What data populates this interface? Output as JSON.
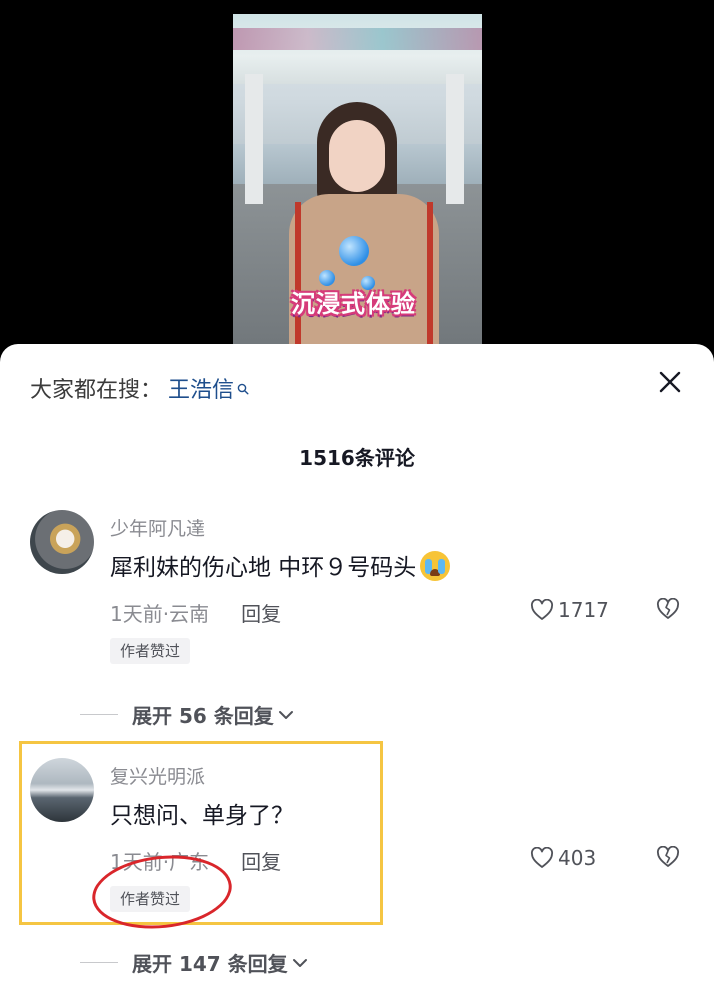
{
  "video": {
    "caption": "沉浸式体验"
  },
  "search": {
    "prefix": "大家都在搜：",
    "term": "王浩信"
  },
  "comments_header": {
    "title": "1516条评论"
  },
  "comments": [
    {
      "username": "少年阿凡達",
      "text": "犀利妹的伤心地  中环９号码头",
      "meta": "1天前·云南",
      "reply_label": "回复",
      "likes": "1717",
      "badge": "作者赞过",
      "expand_label": "展开 56 条回复"
    },
    {
      "username": "复兴光明派",
      "text": "只想问、单身了？",
      "meta": "1天前·广东",
      "reply_label": "回复",
      "likes": "403",
      "badge": "作者赞过",
      "expand_label": "展开 147 条回复"
    }
  ],
  "colors": {
    "search_term": "#1e4e8c",
    "highlight_box": "#f5c542",
    "circle_mark": "#d9262b"
  }
}
